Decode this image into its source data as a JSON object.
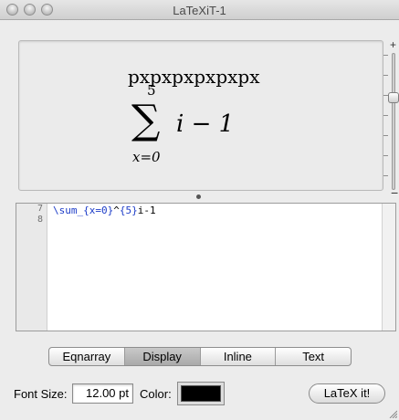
{
  "window": {
    "title": "LaTeXiT-1"
  },
  "preview": {
    "line1": "pxpxpxpxpxpx",
    "sum_upper": "5",
    "sum_symbol": "∑",
    "sum_lower": "x=0",
    "sum_body": "i − 1"
  },
  "zoom": {
    "plus": "+",
    "minus": "−"
  },
  "editor": {
    "line_numbers": [
      "7",
      "8"
    ],
    "code": {
      "kw1": "\\sum_{x=0}",
      "mid": "^",
      "kw2": "{5}",
      "rest": "i-1"
    }
  },
  "modes": {
    "items": [
      "Eqnarray",
      "Display",
      "Inline",
      "Text"
    ],
    "selected": "Display"
  },
  "bottom": {
    "font_size_label": "Font Size:",
    "font_size_value": "12.00 pt",
    "color_label": "Color:",
    "color_value": "#000000",
    "latex_button": "LaTeX it!"
  }
}
